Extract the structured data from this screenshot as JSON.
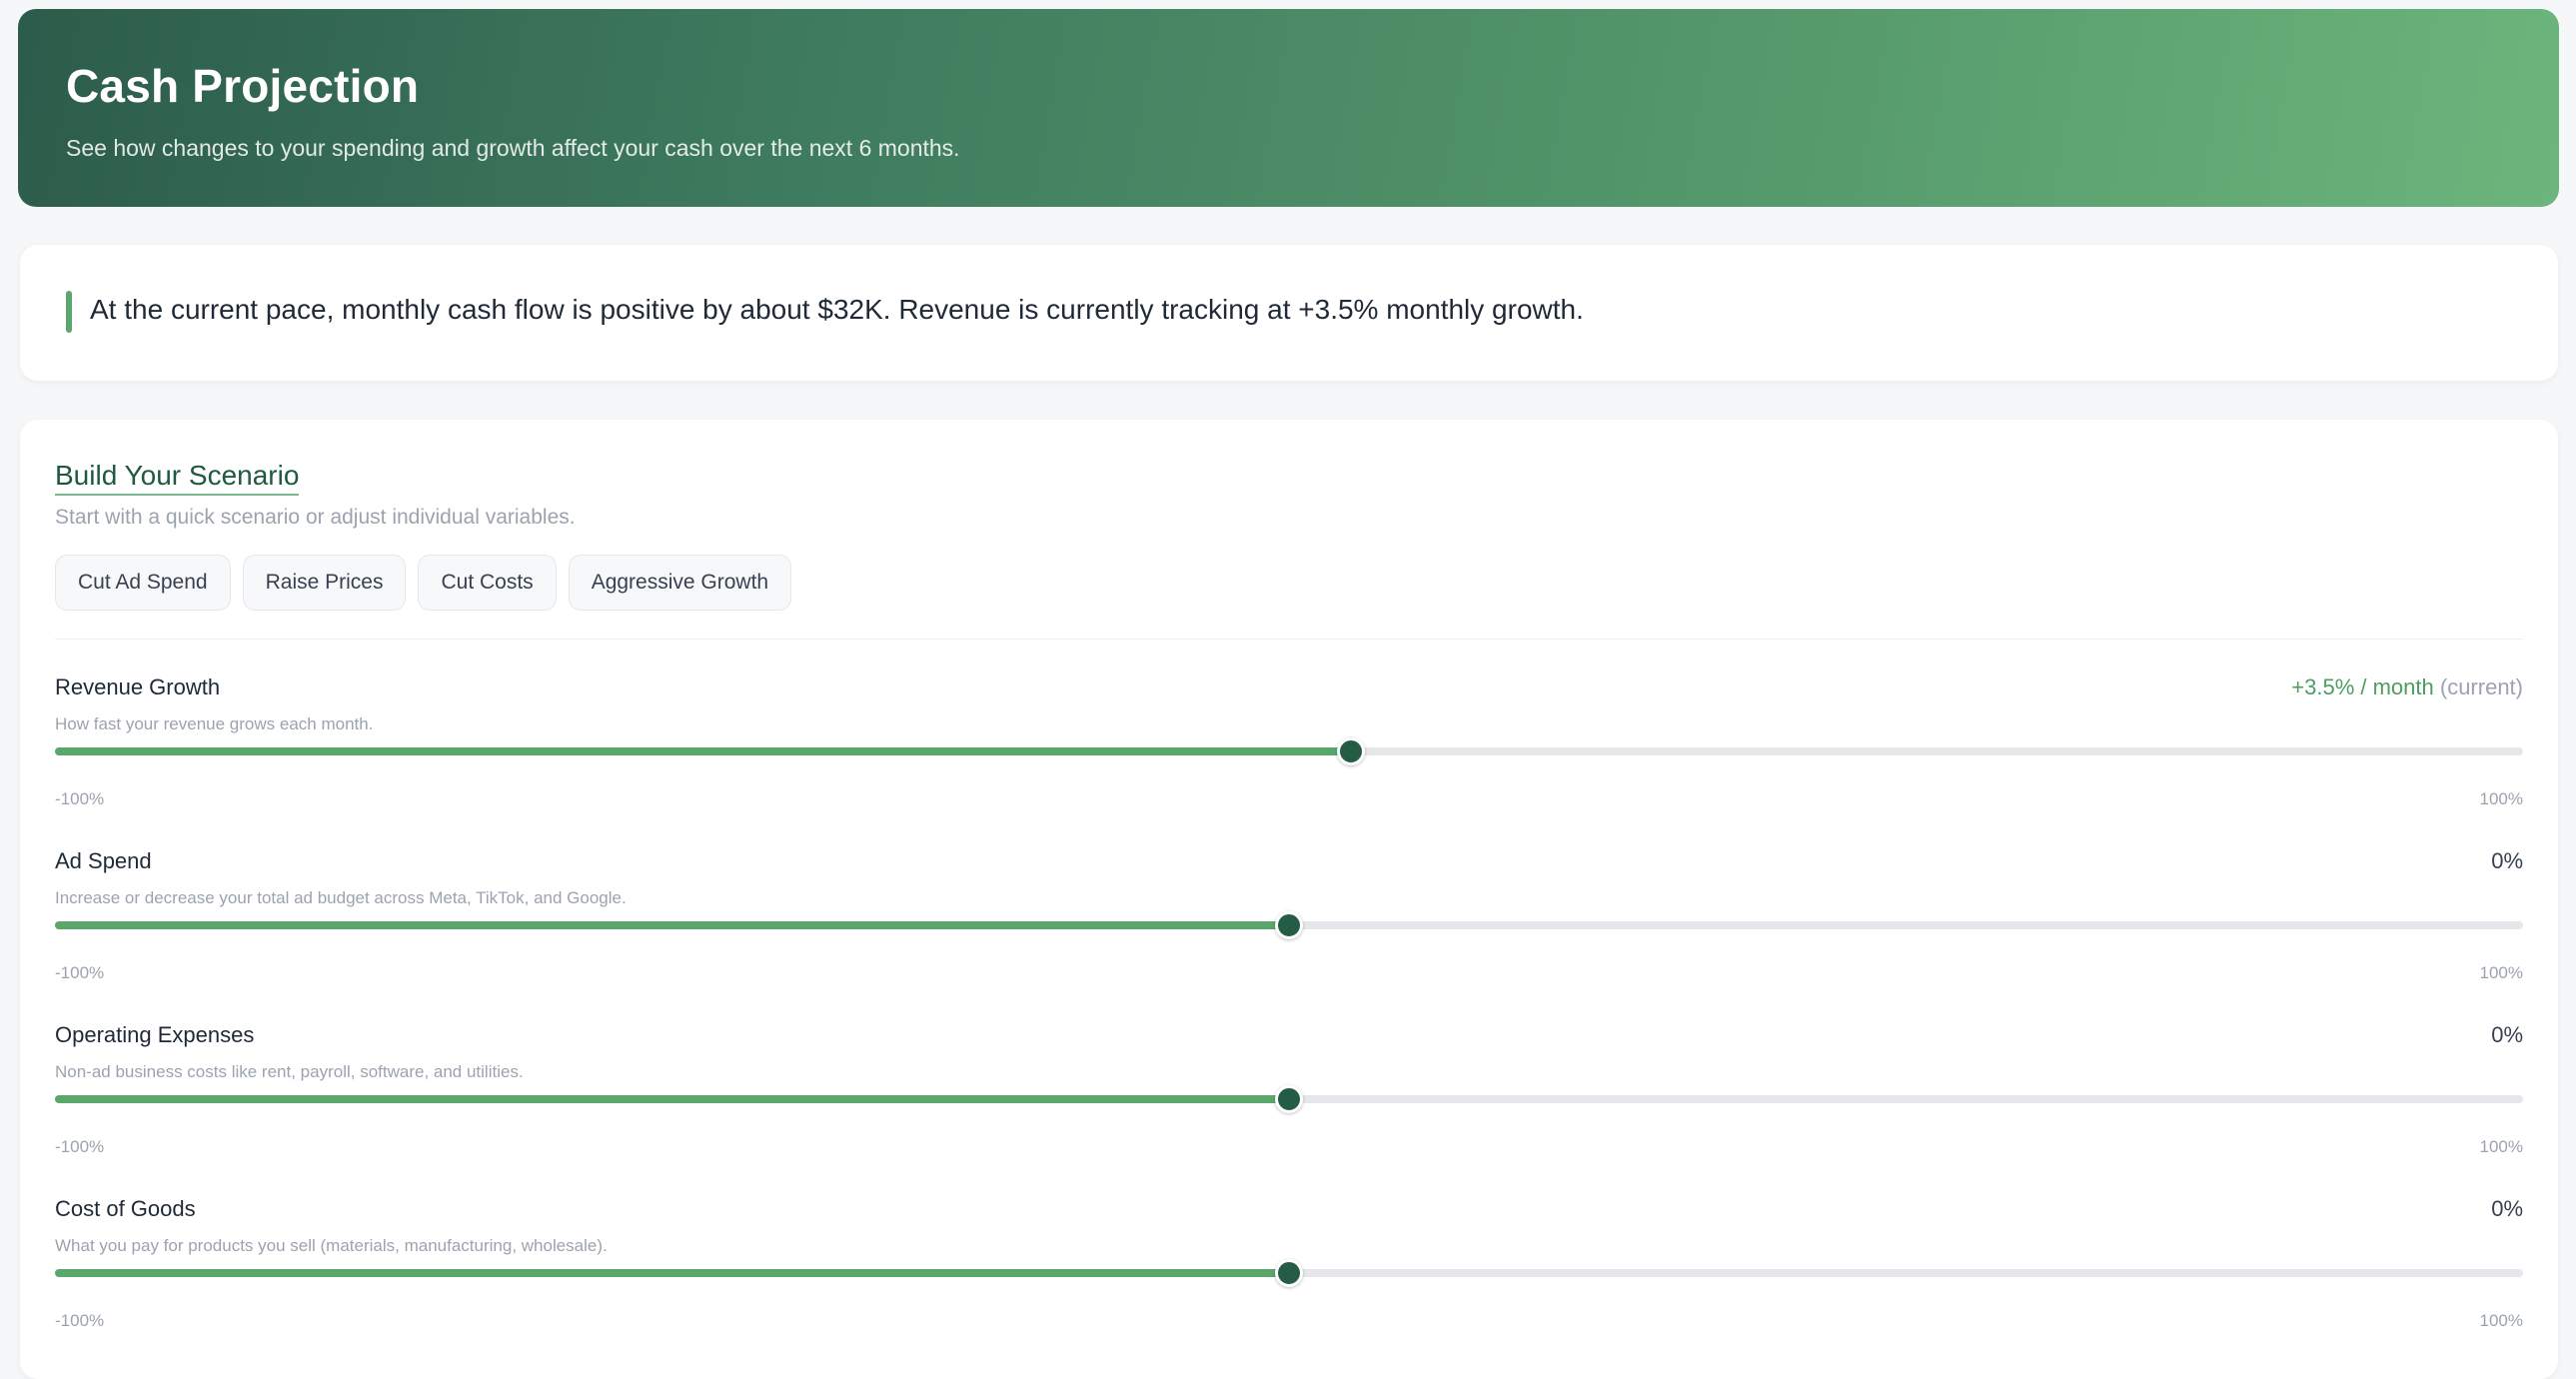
{
  "header": {
    "title": "Cash Projection",
    "subtitle": "See how changes to your spending and growth affect your cash over the next 6 months."
  },
  "insight": {
    "text": "At the current pace, monthly cash flow is positive by about $32K. Revenue is currently tracking at +3.5% monthly growth."
  },
  "scenario": {
    "title": "Build Your Scenario",
    "subtitle": "Start with a quick scenario or adjust individual variables.",
    "presets": [
      "Cut Ad Spend",
      "Raise Prices",
      "Cut Costs",
      "Aggressive Growth"
    ]
  },
  "sliders": [
    {
      "label": "Revenue Growth",
      "value": "+3.5% / month",
      "value_note": "(current)",
      "description": "How fast your revenue grows each month.",
      "min": "-100%",
      "max": "100%",
      "fill_fraction": 0.525
    },
    {
      "label": "Ad Spend",
      "value": "0%",
      "value_note": "",
      "description": "Increase or decrease your total ad budget across Meta, TikTok, and Google.",
      "min": "-100%",
      "max": "100%",
      "fill_fraction": 0.5
    },
    {
      "label": "Operating Expenses",
      "value": "0%",
      "value_note": "",
      "description": "Non-ad business costs like rent, payroll, software, and utilities.",
      "min": "-100%",
      "max": "100%",
      "fill_fraction": 0.5
    },
    {
      "label": "Cost of Goods",
      "value": "0%",
      "value_note": "",
      "description": "What you pay for products you sell (materials, manufacturing, wholesale).",
      "min": "-100%",
      "max": "100%",
      "fill_fraction": 0.5
    }
  ],
  "colors": {
    "accent": "#5aa66b",
    "thumb": "#245c46",
    "header_start": "#2c5c4b",
    "header_end": "#6cb57c"
  }
}
